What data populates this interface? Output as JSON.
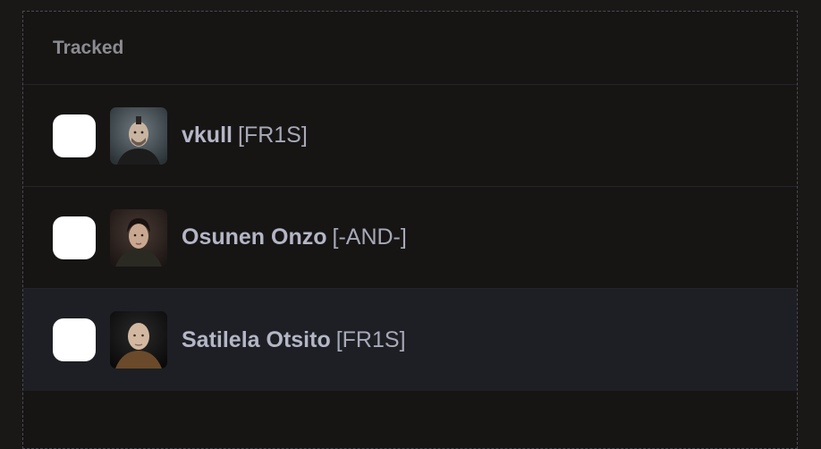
{
  "section": {
    "title": "Tracked"
  },
  "characters": [
    {
      "name": "vkull",
      "ticker": "[FR1S]",
      "checked": false,
      "avatar_icon": "character-portrait-icon"
    },
    {
      "name": "Osunen Onzo",
      "ticker": "[-AND-]",
      "checked": false,
      "avatar_icon": "character-portrait-icon"
    },
    {
      "name": "Satilela Otsito",
      "ticker": "[FR1S]",
      "checked": false,
      "avatar_icon": "character-portrait-icon"
    }
  ],
  "colors": {
    "background": "#1a1817",
    "highlight_row": "#1d1f24",
    "name_text": "#b4b6c6",
    "header_text": "#8b8b90"
  }
}
